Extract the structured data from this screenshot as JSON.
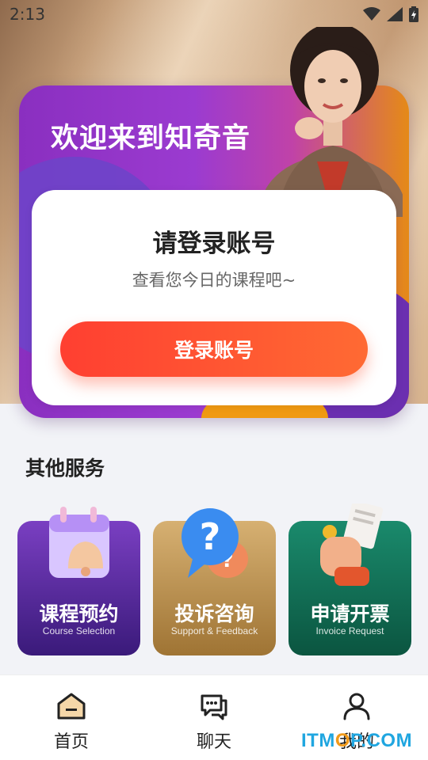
{
  "status_bar": {
    "time": "2:13"
  },
  "banner": {
    "title": "欢迎来到知奇音"
  },
  "login_card": {
    "title": "请登录账号",
    "subtitle": "查看您今日的课程吧~",
    "button_label": "登录账号"
  },
  "services": {
    "section_title": "其他服务",
    "items": [
      {
        "label": "课程预约",
        "sub": "Course Selection"
      },
      {
        "label": "投诉咨询",
        "sub": "Support & Feedback"
      },
      {
        "label": "申请开票",
        "sub": "Invoice Request"
      }
    ]
  },
  "tabbar": {
    "items": [
      {
        "label": "首页",
        "icon": "home-icon"
      },
      {
        "label": "聊天",
        "icon": "chat-icon"
      },
      {
        "label": "我的",
        "icon": "profile-icon"
      }
    ]
  },
  "watermark": {
    "text_a": "ITM",
    "text_b": "P.COM"
  }
}
